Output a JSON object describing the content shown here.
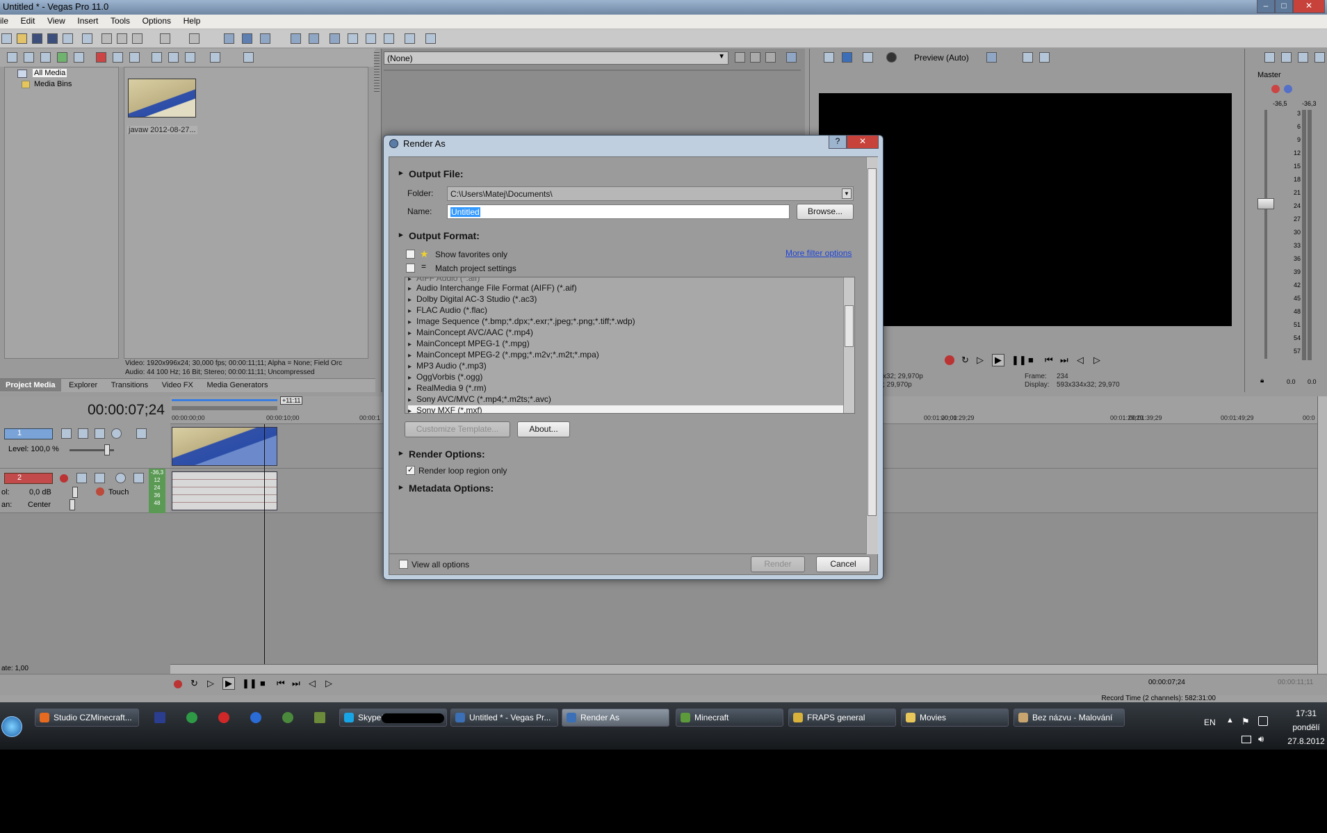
{
  "window": {
    "title": "Untitled * - Vegas Pro 11.0",
    "minimize": "–",
    "maximize": "□",
    "close": "✕"
  },
  "menu": [
    "ile",
    "Edit",
    "View",
    "Insert",
    "Tools",
    "Options",
    "Help"
  ],
  "project_media": {
    "tree": [
      {
        "label": "All Media",
        "selected": true
      },
      {
        "label": "Media Bins",
        "selected": false
      }
    ],
    "clip_name": "javaw 2012-08-27...",
    "info_line1": "Video: 1920x996x24; 30,000 fps; 00:00:11;11; Alpha = None; Field Orc",
    "info_line2": "Audio: 44 100 Hz; 16 Bit; Stereo; 00:00:11;11; Uncompressed",
    "tabs": [
      "Project Media",
      "Explorer",
      "Transitions",
      "Video FX",
      "Media Generators"
    ]
  },
  "trimmer": {
    "dropdown_value": "(None)"
  },
  "preview": {
    "mode": "Preview (Auto)",
    "info_left_1": "x32; 29,970p",
    "info_left_2": "; 29,970p",
    "frame_label": "Frame:",
    "frame_value": "234",
    "display_label": "Display:",
    "display_value": "593x334x32; 29,970"
  },
  "master": {
    "label": "Master",
    "peak_left": "-36,5",
    "peak_right": "-36,3",
    "scale": [
      "3",
      "6",
      "9",
      "12",
      "15",
      "18",
      "21",
      "24",
      "27",
      "30",
      "33",
      "36",
      "39",
      "42",
      "45",
      "48",
      "51",
      "54",
      "57"
    ],
    "level_left": "0.0",
    "level_right": "0.0"
  },
  "timeline": {
    "timecode": "00:00:07;24",
    "loop_length": "+11:11",
    "ruler": [
      "00:00:00;00",
      "00:00:10;00",
      "00:00:1",
      "00:01:20;00",
      "00:01:29;29",
      "00:01:39;29",
      "00:01:49;29",
      "00:0"
    ],
    "track1": {
      "number": "1",
      "level": "Level: 100,0 %"
    },
    "track2": {
      "number": "2",
      "vol_label": "ol:",
      "vol_value": "0,0 dB",
      "touch": "Touch",
      "pan_label": "an:",
      "pan_value": "Center",
      "meter": [
        "-36,3",
        "12",
        "24",
        "36",
        "48"
      ]
    },
    "rate": "ate: 1,00",
    "cursor_time": "00:00:07;24",
    "end_time": "00:00:11;11",
    "record_time": "Record Time (2 channels): 582:31:00"
  },
  "dialog": {
    "title": "Render As",
    "help": "?",
    "close": "✕",
    "output_file": "Output File:",
    "folder_label": "Folder:",
    "folder_value": "C:\\Users\\Matej\\Documents\\",
    "name_label": "Name:",
    "name_value": "Untitled",
    "browse": "Browse...",
    "output_format": "Output Format:",
    "show_favorites": "Show favorites only",
    "match_project": "Match project settings",
    "more_filter": "More filter options",
    "formats": [
      "AIFF Audio (*.aif)",
      "Audio Interchange File Format (AIFF) (*.aif)",
      "Dolby Digital AC-3 Studio (*.ac3)",
      "FLAC Audio (*.flac)",
      "Image Sequence (*.bmp;*.dpx;*.exr;*.jpeg;*.png;*.tiff;*.wdp)",
      "MainConcept AVC/AAC (*.mp4)",
      "MainConcept MPEG-1 (*.mpg)",
      "MainConcept MPEG-2 (*.mpg;*.m2v;*.m2t;*.mpa)",
      "MP3 Audio (*.mp3)",
      "OggVorbis (*.ogg)",
      "RealMedia 9 (*.rm)",
      "Sony AVC/MVC (*.mp4;*.m2ts;*.avc)",
      "Sony MXF (*.mxf)"
    ],
    "selected_format_index": 12,
    "customize_template": "Customize Template...",
    "about": "About...",
    "render_options": "Render Options:",
    "render_loop": "Render loop region only",
    "render_loop_checked": true,
    "metadata_options": "Metadata Options:",
    "view_all": "View all options",
    "render": "Render",
    "cancel": "Cancel"
  },
  "taskbar": {
    "items": [
      {
        "label": "Studio CZMinecraft...",
        "color": "#e66a1f"
      },
      {
        "label": "Skype™",
        "color": "#18a5e6"
      },
      {
        "label": "Untitled * - Vegas Pr...",
        "color": "#3b6fb6"
      },
      {
        "label": "Render As",
        "color": "#3b6fb6",
        "active": true
      },
      {
        "label": "Minecraft",
        "color": "#5c9a3b"
      },
      {
        "label": "FRAPS general",
        "color": "#d8b23a"
      },
      {
        "label": "Movies",
        "color": "#e8c65a"
      },
      {
        "label": "Bez názvu - Malování",
        "color": "#c8a56e"
      }
    ],
    "lang": "EN",
    "time": "17:31",
    "day": "pondělí",
    "date": "27.8.2012"
  },
  "colors": {
    "dialog_frame": "#c0cfdf",
    "dialog_body": "#9b9b9b",
    "link": "#1d44d8",
    "selection": "#3399ff"
  }
}
